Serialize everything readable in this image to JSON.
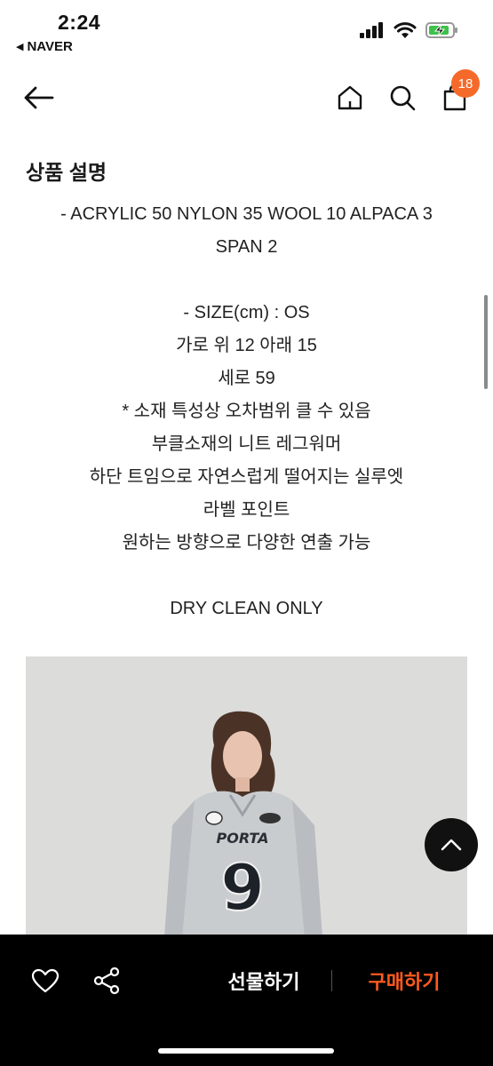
{
  "status_bar": {
    "time": "2:24",
    "back_app": "NAVER",
    "icons": [
      "signal-icon",
      "wifi-icon",
      "battery-charging-icon"
    ]
  },
  "nav": {
    "icons": [
      "back-arrow-icon",
      "home-icon",
      "search-icon",
      "cart-icon"
    ],
    "cart_count": "18"
  },
  "section": {
    "title": "상품 설명"
  },
  "description": {
    "lines": [
      "- ACRYLIC 50 NYLON 35 WOOL 10 ALPACA 3",
      "SPAN 2",
      "",
      "- SIZE(cm) : OS",
      "가로 위 12 아래 15",
      "세로 59",
      "* 소재 특성상 오차범위 클 수 있음",
      "부클소재의 니트 레그워머",
      "하단 트임으로 자연스럽게 떨어지는 실루엣",
      "라벨 포인트",
      "원하는 방향으로 다양한 연출 가능",
      "",
      "DRY CLEAN ONLY"
    ]
  },
  "product_image": {
    "shirt_number": "9",
    "shirt_text": "PORTA"
  },
  "bottom_bar": {
    "gift_label": "선물하기",
    "buy_label": "구매하기",
    "icons": [
      "heart-icon",
      "share-icon"
    ],
    "accent_color": "#ff5a1f"
  },
  "scroll_top": {
    "icon": "chevron-up-icon"
  }
}
